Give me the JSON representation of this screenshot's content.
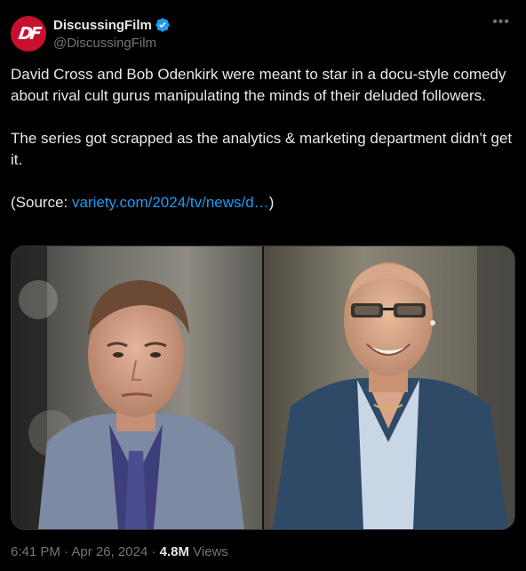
{
  "author": {
    "display_name": "DiscussingFilm",
    "handle": "@DiscussingFilm",
    "verified": true,
    "avatar_logo_text": "DF",
    "avatar_color": "#c8102e",
    "verified_color": "#1d9bf0"
  },
  "tweet": {
    "paragraph_1": "David Cross and Bob Odenkirk were meant to star in a docu-style comedy about rival cult gurus manipulating the minds of their deluded followers.",
    "paragraph_2": "The series got scrapped as the analytics & marketing department didn’t get it.",
    "source_prefix": "(Source: ",
    "source_link": "variety.com/2024/tv/news/d…",
    "source_suffix": ")"
  },
  "media": {
    "left_photo": "man-in-plaid-suit-photo",
    "right_photo": "smiling-man-in-glasses-photo"
  },
  "meta": {
    "time": "6:41 PM",
    "separator": " · ",
    "date": "Apr 26, 2024",
    "views_count": "4.8M",
    "views_label": " Views"
  },
  "icons": {
    "more": "more-options-icon",
    "verified": "verified-badge-icon"
  }
}
